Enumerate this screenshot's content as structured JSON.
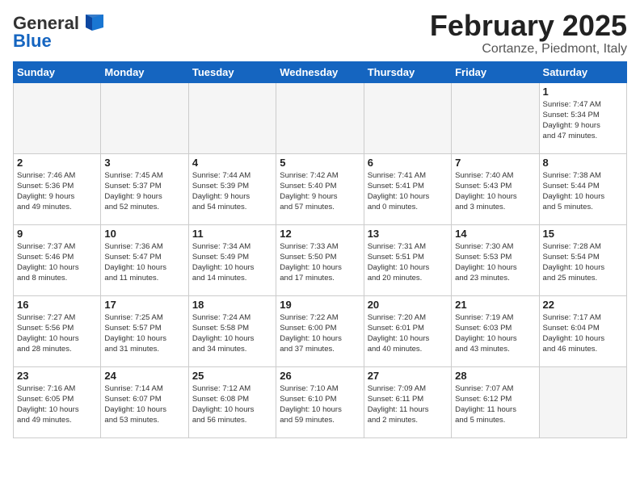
{
  "header": {
    "logo_line1": "General",
    "logo_line2": "Blue",
    "month": "February 2025",
    "location": "Cortanze, Piedmont, Italy"
  },
  "weekdays": [
    "Sunday",
    "Monday",
    "Tuesday",
    "Wednesday",
    "Thursday",
    "Friday",
    "Saturday"
  ],
  "weeks": [
    [
      {
        "day": "",
        "info": ""
      },
      {
        "day": "",
        "info": ""
      },
      {
        "day": "",
        "info": ""
      },
      {
        "day": "",
        "info": ""
      },
      {
        "day": "",
        "info": ""
      },
      {
        "day": "",
        "info": ""
      },
      {
        "day": "1",
        "info": "Sunrise: 7:47 AM\nSunset: 5:34 PM\nDaylight: 9 hours\nand 47 minutes."
      }
    ],
    [
      {
        "day": "2",
        "info": "Sunrise: 7:46 AM\nSunset: 5:36 PM\nDaylight: 9 hours\nand 49 minutes."
      },
      {
        "day": "3",
        "info": "Sunrise: 7:45 AM\nSunset: 5:37 PM\nDaylight: 9 hours\nand 52 minutes."
      },
      {
        "day": "4",
        "info": "Sunrise: 7:44 AM\nSunset: 5:39 PM\nDaylight: 9 hours\nand 54 minutes."
      },
      {
        "day": "5",
        "info": "Sunrise: 7:42 AM\nSunset: 5:40 PM\nDaylight: 9 hours\nand 57 minutes."
      },
      {
        "day": "6",
        "info": "Sunrise: 7:41 AM\nSunset: 5:41 PM\nDaylight: 10 hours\nand 0 minutes."
      },
      {
        "day": "7",
        "info": "Sunrise: 7:40 AM\nSunset: 5:43 PM\nDaylight: 10 hours\nand 3 minutes."
      },
      {
        "day": "8",
        "info": "Sunrise: 7:38 AM\nSunset: 5:44 PM\nDaylight: 10 hours\nand 5 minutes."
      }
    ],
    [
      {
        "day": "9",
        "info": "Sunrise: 7:37 AM\nSunset: 5:46 PM\nDaylight: 10 hours\nand 8 minutes."
      },
      {
        "day": "10",
        "info": "Sunrise: 7:36 AM\nSunset: 5:47 PM\nDaylight: 10 hours\nand 11 minutes."
      },
      {
        "day": "11",
        "info": "Sunrise: 7:34 AM\nSunset: 5:49 PM\nDaylight: 10 hours\nand 14 minutes."
      },
      {
        "day": "12",
        "info": "Sunrise: 7:33 AM\nSunset: 5:50 PM\nDaylight: 10 hours\nand 17 minutes."
      },
      {
        "day": "13",
        "info": "Sunrise: 7:31 AM\nSunset: 5:51 PM\nDaylight: 10 hours\nand 20 minutes."
      },
      {
        "day": "14",
        "info": "Sunrise: 7:30 AM\nSunset: 5:53 PM\nDaylight: 10 hours\nand 23 minutes."
      },
      {
        "day": "15",
        "info": "Sunrise: 7:28 AM\nSunset: 5:54 PM\nDaylight: 10 hours\nand 25 minutes."
      }
    ],
    [
      {
        "day": "16",
        "info": "Sunrise: 7:27 AM\nSunset: 5:56 PM\nDaylight: 10 hours\nand 28 minutes."
      },
      {
        "day": "17",
        "info": "Sunrise: 7:25 AM\nSunset: 5:57 PM\nDaylight: 10 hours\nand 31 minutes."
      },
      {
        "day": "18",
        "info": "Sunrise: 7:24 AM\nSunset: 5:58 PM\nDaylight: 10 hours\nand 34 minutes."
      },
      {
        "day": "19",
        "info": "Sunrise: 7:22 AM\nSunset: 6:00 PM\nDaylight: 10 hours\nand 37 minutes."
      },
      {
        "day": "20",
        "info": "Sunrise: 7:20 AM\nSunset: 6:01 PM\nDaylight: 10 hours\nand 40 minutes."
      },
      {
        "day": "21",
        "info": "Sunrise: 7:19 AM\nSunset: 6:03 PM\nDaylight: 10 hours\nand 43 minutes."
      },
      {
        "day": "22",
        "info": "Sunrise: 7:17 AM\nSunset: 6:04 PM\nDaylight: 10 hours\nand 46 minutes."
      }
    ],
    [
      {
        "day": "23",
        "info": "Sunrise: 7:16 AM\nSunset: 6:05 PM\nDaylight: 10 hours\nand 49 minutes."
      },
      {
        "day": "24",
        "info": "Sunrise: 7:14 AM\nSunset: 6:07 PM\nDaylight: 10 hours\nand 53 minutes."
      },
      {
        "day": "25",
        "info": "Sunrise: 7:12 AM\nSunset: 6:08 PM\nDaylight: 10 hours\nand 56 minutes."
      },
      {
        "day": "26",
        "info": "Sunrise: 7:10 AM\nSunset: 6:10 PM\nDaylight: 10 hours\nand 59 minutes."
      },
      {
        "day": "27",
        "info": "Sunrise: 7:09 AM\nSunset: 6:11 PM\nDaylight: 11 hours\nand 2 minutes."
      },
      {
        "day": "28",
        "info": "Sunrise: 7:07 AM\nSunset: 6:12 PM\nDaylight: 11 hours\nand 5 minutes."
      },
      {
        "day": "",
        "info": ""
      }
    ]
  ]
}
